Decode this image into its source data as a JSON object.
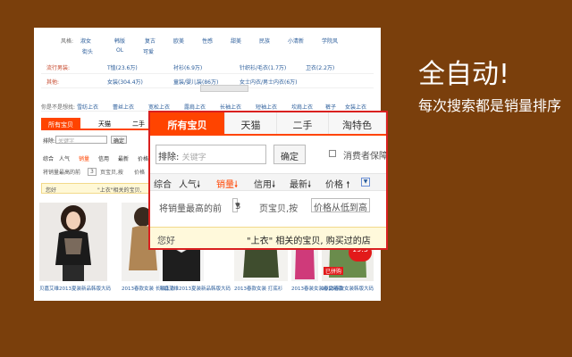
{
  "right_text": {
    "headline": "全自动!",
    "subline": "每次搜索都是销量排序"
  },
  "bg_page": {
    "style_label": "风格:",
    "styles": [
      "淑女",
      "韩版",
      "复古",
      "欧美",
      "性感",
      "甜美",
      "民族",
      "小清新",
      "学院风",
      "街头",
      "OL",
      "可爱"
    ],
    "row1_head": "流行男装:",
    "row1_items": [
      "T恤(23.6万)",
      "衬衫(6.9万)",
      "针织衫/毛衣(1.7万)",
      "卫衣(2.2万)"
    ],
    "row2_head": "其他:",
    "row2_items": [
      "女装(304.4万)",
      "童装/婴儿装(86万)",
      "女士内衣/男士内衣(6万)"
    ],
    "crumb_label": "你是不是想找:",
    "crumb_items": [
      "雪纺上衣",
      "蕾丝上衣",
      "宽松上衣",
      "露肩上衣",
      "长袖上衣",
      "短袖上衣",
      "坎肩上衣",
      "裤子",
      "女装上衣"
    ],
    "tabs": [
      "所有宝贝",
      "天猫",
      "二手"
    ],
    "search_label": "排除:",
    "search_placeholder": "关键字",
    "confirm": "确定",
    "sort_items": [
      "综合",
      "人气",
      "销量",
      "信用",
      "最新",
      "价格"
    ],
    "sub_text": "将销量最高的前",
    "sub_num": "3",
    "sub_text2": "页宝贝,按",
    "sub_sort": "价格",
    "tip_left": "您好",
    "tip_mid": "\"上衣\"相关的宝贝,",
    "products": [
      "贝嘉艾维2013夏装新品韩版大码",
      "2013春款女装 长袖上衣",
      "贝嘉艾维2013夏装新品韩版大码",
      "2013春款女装 打底衫",
      "2013春装女装春夏新款",
      "2013春款女装韩版大码"
    ],
    "badge": "19.5",
    "badge_sub": "已拼购"
  },
  "panel": {
    "tabs": [
      "所有宝贝",
      "天猫",
      "二手",
      "淘特色"
    ],
    "search_label": "排除:",
    "search_placeholder": "关键字",
    "confirm": "确定",
    "consumer": "消费者保障",
    "sort": {
      "zonghe": "综合",
      "renqi": "人气",
      "xiaoliang": "销量",
      "xinyong": "信用",
      "zuixin": "最新",
      "jiage": "价格"
    },
    "sub": {
      "prefix": "将销量最高的前",
      "num": "3",
      "mid": "页宝贝,按",
      "select": "价格从低到高"
    },
    "tip": {
      "left": "您好",
      "right": "\"上衣\" 相关的宝贝, 购买过的店"
    }
  }
}
